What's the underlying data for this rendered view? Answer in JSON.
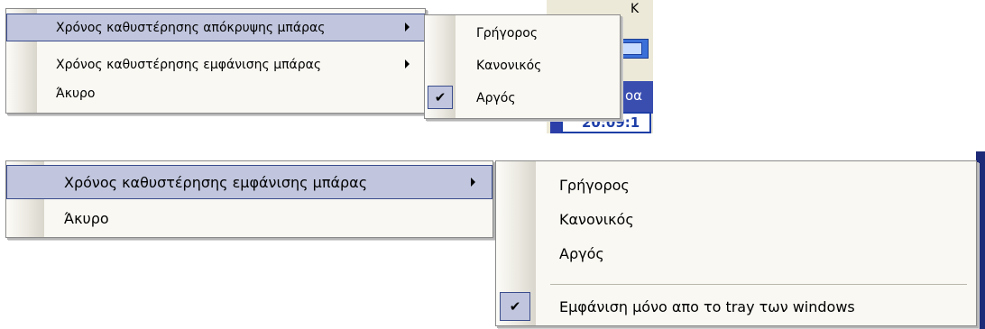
{
  "top": {
    "background_app": {
      "header_text": "οα",
      "clock_text": "20:09:1",
      "partial_top_text": "Κ"
    },
    "main_menu": {
      "items": [
        {
          "label": "Χρόνος καθυστέρησης απόκρυψης μπάρας",
          "has_submenu": true,
          "highlighted": true
        },
        {
          "label": "Χρόνος καθυστέρησης εμφάνισης μπάρας",
          "has_submenu": true,
          "highlighted": false
        },
        {
          "label": "Άκυρο",
          "has_submenu": false,
          "highlighted": false
        }
      ]
    },
    "submenu": {
      "items": [
        {
          "label": "Γρήγορος",
          "checked": false
        },
        {
          "label": "Κανονικός",
          "checked": false
        },
        {
          "label": "Αργός",
          "checked": true
        }
      ]
    }
  },
  "bottom": {
    "main_menu": {
      "items": [
        {
          "label": "Χρόνος καθυστέρησης εμφάνισης μπάρας",
          "has_submenu": true,
          "highlighted": true
        },
        {
          "label": "Άκυρο",
          "has_submenu": false,
          "highlighted": false
        }
      ]
    },
    "submenu": {
      "items": [
        {
          "label": "Γρήγορος",
          "checked": false
        },
        {
          "label": "Κανονικός",
          "checked": false
        },
        {
          "label": "Αργός",
          "checked": false
        },
        {
          "label": "Εμφάνιση μόνο απο το tray των windows",
          "checked": true
        }
      ]
    }
  },
  "icons": {
    "submenu_arrow": "submenu-arrow-icon",
    "check_mark": "check-mark-icon",
    "check_glyph": "✔"
  },
  "colors": {
    "highlight": "#c1c6de",
    "highlight_border": "#3a4c8c",
    "menu_background": "#f9f8f3"
  }
}
